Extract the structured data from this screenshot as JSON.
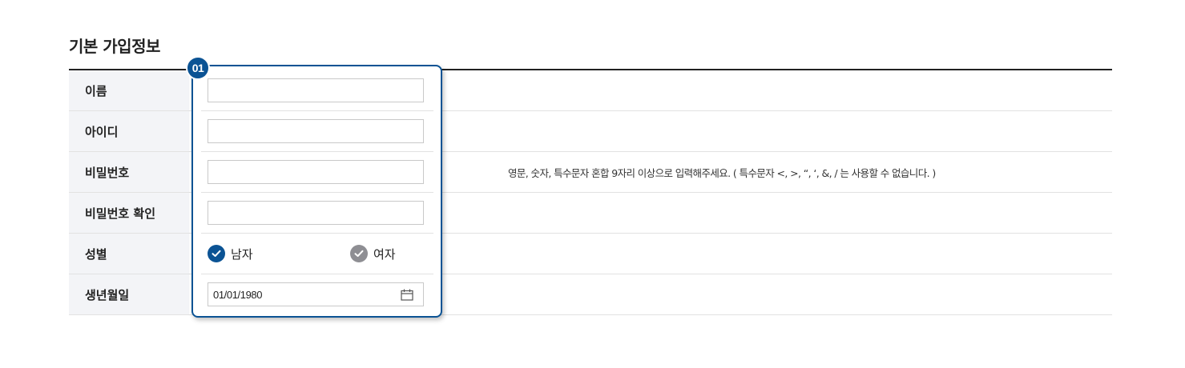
{
  "section": {
    "title": "기본 가입정보"
  },
  "rows": [
    {
      "label": "이름"
    },
    {
      "label": "아이디"
    },
    {
      "label": "비밀번호",
      "help": "영문, 숫자, 특수문자 혼합 9자리 이상으로 입력해주세요. ( 특수문자 <, >, “, ‘, &, / 는 사용할 수 없습니다. )"
    },
    {
      "label": "비밀번호 확인"
    },
    {
      "label": "성별"
    },
    {
      "label": "생년월일"
    }
  ],
  "inputs": {
    "name": "",
    "id": "",
    "password": "",
    "password_confirm": ""
  },
  "gender": {
    "options": [
      "남자",
      "여자"
    ],
    "selected": "남자"
  },
  "birthdate": {
    "value": "01/01/1980",
    "icon": "calendar-icon"
  },
  "badge": {
    "label": "01"
  },
  "colors": {
    "accent": "#0b5394",
    "unselected": "#8e8e93",
    "label_bg": "#f3f4f7"
  }
}
